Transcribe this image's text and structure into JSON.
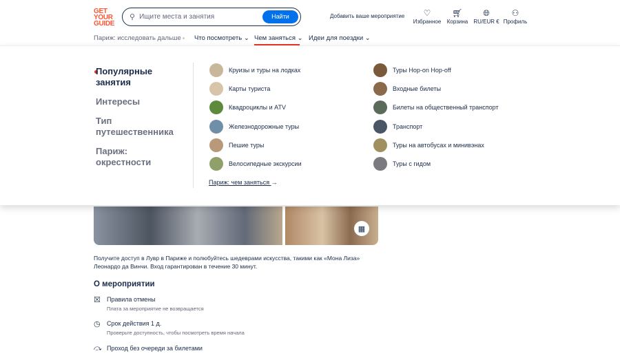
{
  "header": {
    "logo": "GET YOUR GUIDE",
    "search_placeholder": "Ищите места и занятия",
    "search_button": "Найти",
    "add_activity": "Добавить ваше мероприятие",
    "icons": [
      {
        "name": "heart-icon",
        "label": "Избранное"
      },
      {
        "name": "cart-icon",
        "label": "Корзина"
      },
      {
        "name": "globe-icon",
        "label": "RU/EUR €"
      },
      {
        "name": "profile-icon",
        "label": "Профиль"
      }
    ]
  },
  "nav": {
    "explore": "Париж: исследовать дальше",
    "items": [
      "Что посмотреть",
      "Чем заняться",
      "Идеи для поездки"
    ]
  },
  "menu": {
    "categories": [
      "Популярные занятия",
      "Интересы",
      "Тип путешественника",
      "Париж: окрестности"
    ],
    "col1": [
      "Круизы и туры на лодках",
      "Карты туриста",
      "Квадроциклы и ATV",
      "Железнодорожные туры",
      "Пешие туры",
      "Велосипедные экскурсии"
    ],
    "col2": [
      "Туры Hop-on Hop-off",
      "Входные билеты",
      "Билеты на общественный транспорт",
      "Транспорт",
      "Туры на автобусах и минивэнах",
      "Туры с гидом"
    ],
    "more_link": "Париж: чем заняться"
  },
  "content": {
    "description": "Получите доступ в Лувр в Париже и полюбуйтесь шедеврами искусства, такими как «Мона Лиза» Леонардо да Винчи. Вход гарантирован в течение 30 минут.",
    "about_title": "О мероприятии",
    "features": [
      {
        "title": "Правила отмены",
        "sub": "Плата за мероприятие не возвращается"
      },
      {
        "title": "Срок действия 1 д.",
        "sub": "Проверьте доступность, чтобы посмотреть время начала"
      },
      {
        "title": "Проход без очереди за билетами",
        "sub": ""
      }
    ]
  }
}
